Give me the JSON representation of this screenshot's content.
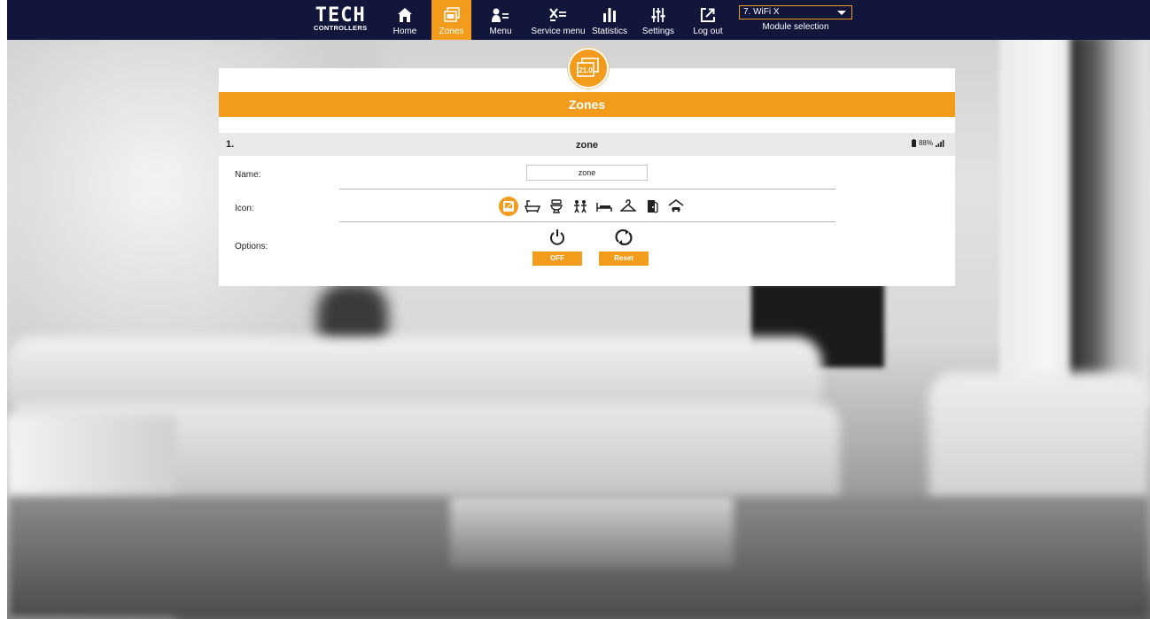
{
  "brand": {
    "logo_main": "TECH",
    "logo_sub": "CONTROLLERS"
  },
  "nav": {
    "home": "Home",
    "zones": "Zones",
    "menu": "Menu",
    "service_menu": "Service menu",
    "statistics": "Statistics",
    "settings": "Settings",
    "logout": "Log out"
  },
  "module": {
    "selected": "7. WiFi X",
    "label": "Module selection"
  },
  "badge": {
    "value": "21.0"
  },
  "panel": {
    "title": "Zones",
    "zone": {
      "number": "1.",
      "name": "zone",
      "battery": "88%"
    },
    "name_label": "Name:",
    "name_value": "zone",
    "icon_label": "Icon:",
    "options_label": "Options:",
    "off_label": "OFF",
    "reset_label": "Reset",
    "icons": [
      "zone-default-icon",
      "bathtub-icon",
      "toilet-icon",
      "children-icon",
      "bed-icon",
      "hanger-icon",
      "door-icon",
      "garage-icon"
    ],
    "selected_icon_index": 0
  },
  "colors": {
    "accent": "#f39c1b",
    "navbar": "#11163a"
  }
}
